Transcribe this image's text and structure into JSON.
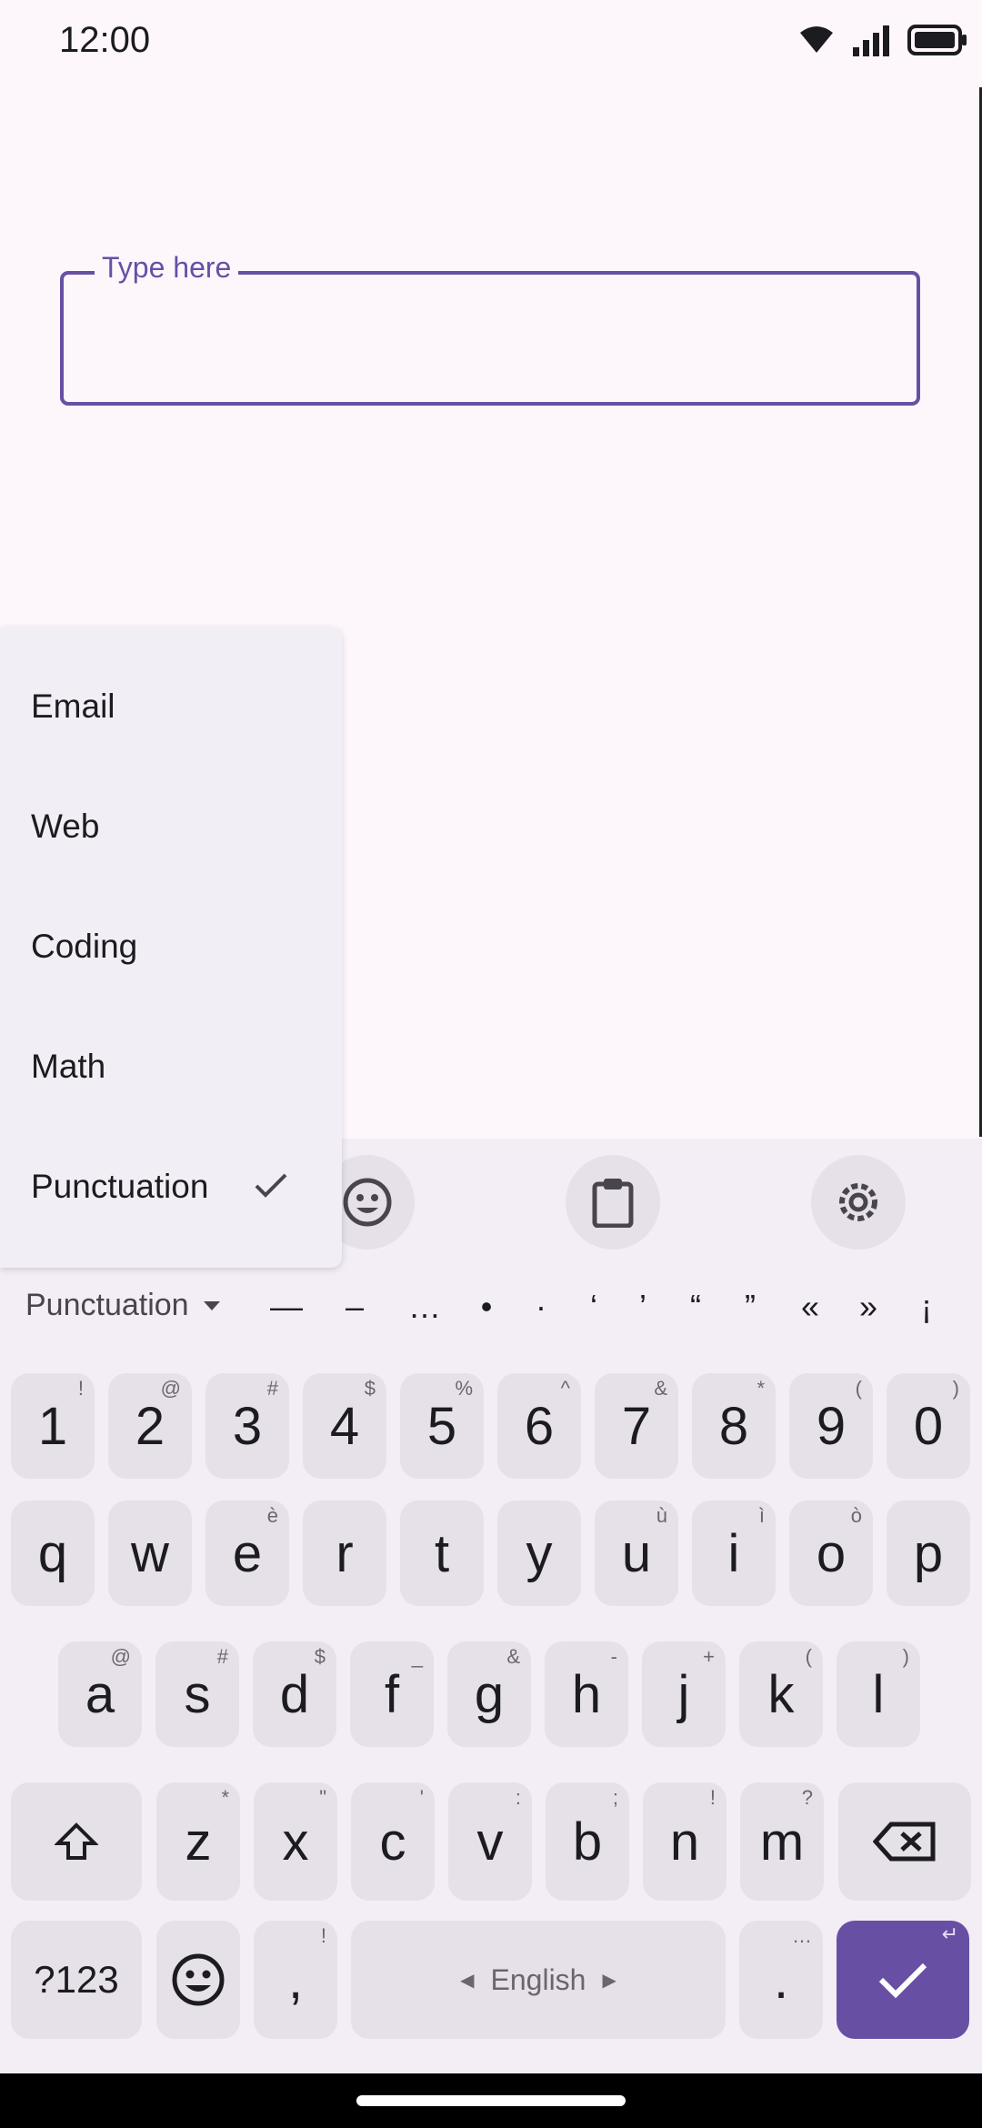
{
  "status": {
    "time": "12:00"
  },
  "field": {
    "label": "Type here",
    "value": ""
  },
  "menu": {
    "items": [
      {
        "label": "Email"
      },
      {
        "label": "Web"
      },
      {
        "label": "Coding"
      },
      {
        "label": "Math"
      },
      {
        "label": "Punctuation",
        "checked": true
      }
    ]
  },
  "strip": {
    "mode_label": "Punctuation",
    "symbols": [
      "—",
      "–",
      "…",
      "•",
      "·",
      "‘",
      "’",
      "“",
      "”",
      "«",
      "»",
      "¡"
    ]
  },
  "keyboard": {
    "row_numbers": [
      {
        "k": "1",
        "h": "!"
      },
      {
        "k": "2",
        "h": "@"
      },
      {
        "k": "3",
        "h": "#"
      },
      {
        "k": "4",
        "h": "$"
      },
      {
        "k": "5",
        "h": "%"
      },
      {
        "k": "6",
        "h": "^"
      },
      {
        "k": "7",
        "h": "&"
      },
      {
        "k": "8",
        "h": "*"
      },
      {
        "k": "9",
        "h": "("
      },
      {
        "k": "0",
        "h": ")"
      }
    ],
    "row_q": [
      {
        "k": "q",
        "h": ""
      },
      {
        "k": "w",
        "h": ""
      },
      {
        "k": "e",
        "h": "è"
      },
      {
        "k": "r",
        "h": ""
      },
      {
        "k": "t",
        "h": ""
      },
      {
        "k": "y",
        "h": ""
      },
      {
        "k": "u",
        "h": "ù"
      },
      {
        "k": "i",
        "h": "ì"
      },
      {
        "k": "o",
        "h": "ò"
      },
      {
        "k": "p",
        "h": ""
      }
    ],
    "row_a": [
      {
        "k": "a",
        "h": "@"
      },
      {
        "k": "s",
        "h": "#"
      },
      {
        "k": "d",
        "h": "$"
      },
      {
        "k": "f",
        "h": "_"
      },
      {
        "k": "g",
        "h": "&"
      },
      {
        "k": "h",
        "h": "-"
      },
      {
        "k": "j",
        "h": "+"
      },
      {
        "k": "k",
        "h": "("
      },
      {
        "k": "l",
        "h": ")"
      }
    ],
    "row_z": [
      {
        "k": "z",
        "h": "*"
      },
      {
        "k": "x",
        "h": "\""
      },
      {
        "k": "c",
        "h": "'"
      },
      {
        "k": "v",
        "h": ":"
      },
      {
        "k": "b",
        "h": ";"
      },
      {
        "k": "n",
        "h": "!"
      },
      {
        "k": "m",
        "h": "?"
      }
    ],
    "symbols_key": "?123",
    "comma_key": ",",
    "comma_hint": "!",
    "space_label": "English",
    "period_key": ".",
    "period_hint": "…"
  },
  "colors": {
    "accent": "#6750a4",
    "key_bg": "#e6e0e9",
    "kb_bg": "#f3edf6"
  }
}
